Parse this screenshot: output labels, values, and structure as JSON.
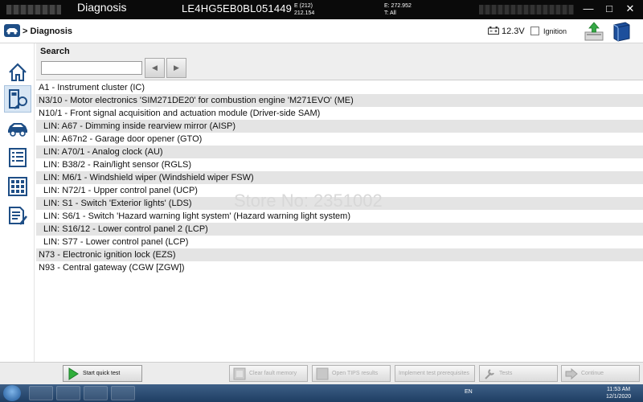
{
  "window": {
    "app_title": "Diagnosis",
    "vin": "LE4HG5EB0BL051449",
    "code_e": "E (212)",
    "code_e_sub": "212.154",
    "code_right": "E: 272.952",
    "code_right_sub": "T: All",
    "minimize": "—",
    "maximize": "□",
    "close": "✕"
  },
  "navbar": {
    "breadcrumb": "> Diagnosis",
    "voltage": "12.3V",
    "ignition_label": "Ignition"
  },
  "leftnav": {
    "items": [
      "home-icon",
      "control-unit-icon",
      "vehicle-icon",
      "list-icon",
      "grid-icon",
      "report-icon"
    ]
  },
  "search": {
    "title": "Search",
    "value": "",
    "prev": "◀",
    "next": "▶"
  },
  "modules": [
    {
      "label": "A1 - Instrument cluster (IC)",
      "indent": false
    },
    {
      "label": "N3/10 - Motor electronics 'SIM271DE20' for combustion engine 'M271EVO' (ME)",
      "indent": false
    },
    {
      "label": "N10/1 - Front signal acquisition and actuation module (Driver-side SAM)",
      "indent": false
    },
    {
      "label": "LIN: A67 - Dimming inside rearview mirror (AISP)",
      "indent": true
    },
    {
      "label": "LIN: A67n2 - Garage door opener (GTO)",
      "indent": true
    },
    {
      "label": "LIN: A70/1 - Analog clock (AU)",
      "indent": true
    },
    {
      "label": "LIN: B38/2 - Rain/light sensor (RGLS)",
      "indent": true
    },
    {
      "label": "LIN: M6/1 - Windshield wiper (Windshield wiper FSW)",
      "indent": true
    },
    {
      "label": "LIN: N72/1 - Upper control panel (UCP)",
      "indent": true
    },
    {
      "label": "LIN: S1 - Switch 'Exterior lights' (LDS)",
      "indent": true
    },
    {
      "label": "LIN: S6/1 - Switch 'Hazard warning light system' (Hazard warning light system)",
      "indent": true
    },
    {
      "label": "LIN: S16/12 - Lower control panel 2 (LCP)",
      "indent": true
    },
    {
      "label": "LIN: S77 - Lower control panel (LCP)",
      "indent": true
    },
    {
      "label": "N73 - Electronic ignition lock (EZS)",
      "indent": false
    },
    {
      "label": "N93 - Central gateway (CGW [ZGW])",
      "indent": false
    }
  ],
  "watermark": "Store No: 2351002",
  "footer": {
    "quick_test": "Start quick test",
    "clear_fault": "Clear fault memory",
    "open_tips": "Open TIPS results",
    "implement_prereq": "Implement test prerequisites",
    "tests": "Tests",
    "continue": "Continue"
  },
  "taskbar": {
    "lang": "EN",
    "clock_time": "11:53 AM",
    "clock_date": "12/1/2020"
  },
  "colors": {
    "accent_blue": "#1e4e86",
    "active_nav": "#d8e6f4",
    "row_alt": "#e4e4e4",
    "green_play": "#2fae3a"
  }
}
